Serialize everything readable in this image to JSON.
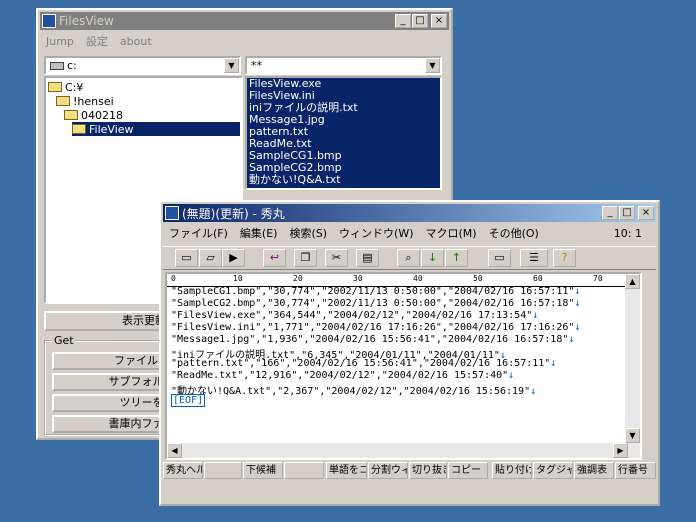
{
  "filesview": {
    "title": "FilesView",
    "menu": [
      "Jump",
      "設定",
      "about"
    ],
    "drive_combo": "c:",
    "filter_combo": "**",
    "tree": [
      "C:¥",
      "!hensei",
      "040218",
      "FileView"
    ],
    "files": [
      "FilesView.exe",
      "FilesView.ini",
      "iniファイルの説明.txt",
      "Message1.jpg",
      "pattern.txt",
      "ReadMe.txt",
      "SampleCG1.bmp",
      "SampleCG2.bmp",
      "動かない!Q&A.txt"
    ],
    "display_button": "表示更新",
    "get_group": "Get",
    "get_buttons": [
      "ファイル名を",
      "サブフォルダ込",
      "ツリーを取",
      "書庫内ファイル"
    ]
  },
  "hidemaru": {
    "title": "(無題)(更新) - 秀丸",
    "menu": [
      "ファイル(F)",
      "編集(E)",
      "検索(S)",
      "ウィンドウ(W)",
      "マクロ(M)",
      "その他(O)"
    ],
    "position": "10: 1",
    "ruler_marks": [
      "0",
      "10",
      "20",
      "30",
      "40",
      "50",
      "60",
      "70"
    ],
    "lines": [
      "\"SampleCG1.bmp\",\"30,774\",\"2002/11/13 0:50:00\",\"2004/02/16 16:57:11\"",
      "\"SampleCG2.bmp\",\"30,774\",\"2002/11/13 0:50:00\",\"2004/02/16 16:57:18\"",
      "\"FilesView.exe\",\"364,544\",\"2004/02/12\",\"2004/02/16 17:13:54\"",
      "\"FilesView.ini\",\"1,771\",\"2004/02/16 17:16:26\",\"2004/02/16 17:16:26\"",
      "\"Message1.jpg\",\"1,936\",\"2004/02/16 15:56:41\",\"2004/02/16 16:57:18\"",
      "\"iniファイルの説明.txt\",\"6,345\",\"2004/01/11\",\"2004/01/11\"",
      "\"pattern.txt\",\"166\",\"2004/02/16 15:56:41\",\"2004/02/16 16:57:11\"",
      "\"ReadMe.txt\",\"12,916\",\"2004/02/12\",\"2004/02/16 15:57:40\"",
      "\"動かない!Q&A.txt\",\"2,367\",\"2004/02/12\",\"2004/02/16 15:56:19\""
    ],
    "return_mark": "↓",
    "eof": "[EOF]",
    "fkeys": [
      "秀丸ヘル",
      "",
      "下候補",
      "",
      "単語をコ",
      "分割ウィ",
      "切り抜き",
      "コピー",
      "貼り付け",
      "タグジャン",
      "強調表",
      "行番号"
    ]
  }
}
